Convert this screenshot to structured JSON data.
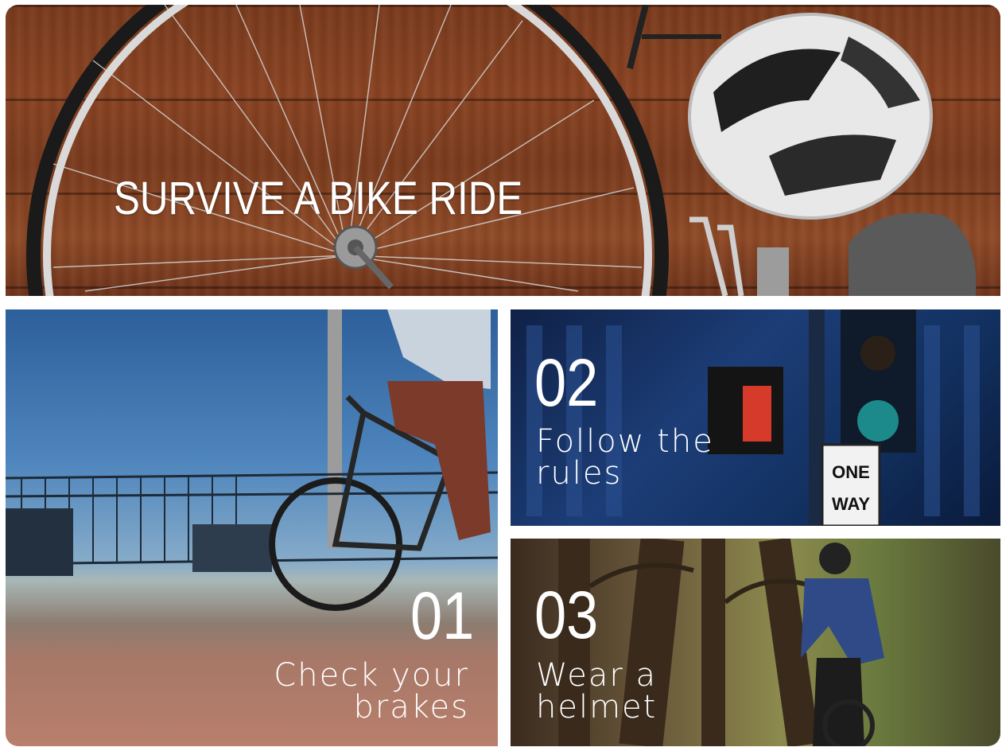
{
  "hero": {
    "title": "SURVIVE A BIKE RIDE"
  },
  "tips": [
    {
      "number": "01",
      "line1": "Check your",
      "line2": "brakes"
    },
    {
      "number": "02",
      "line1": "Follow the",
      "line2": "rules"
    },
    {
      "number": "03",
      "line1": "Wear a",
      "line2": "helmet"
    }
  ],
  "sign": {
    "line1": "ONE",
    "line2": "WAY"
  },
  "colors": {
    "wood": "#7a3a1c",
    "sky": "#2d5f9a",
    "city": "#1c3d77",
    "text": "#ffffff"
  }
}
